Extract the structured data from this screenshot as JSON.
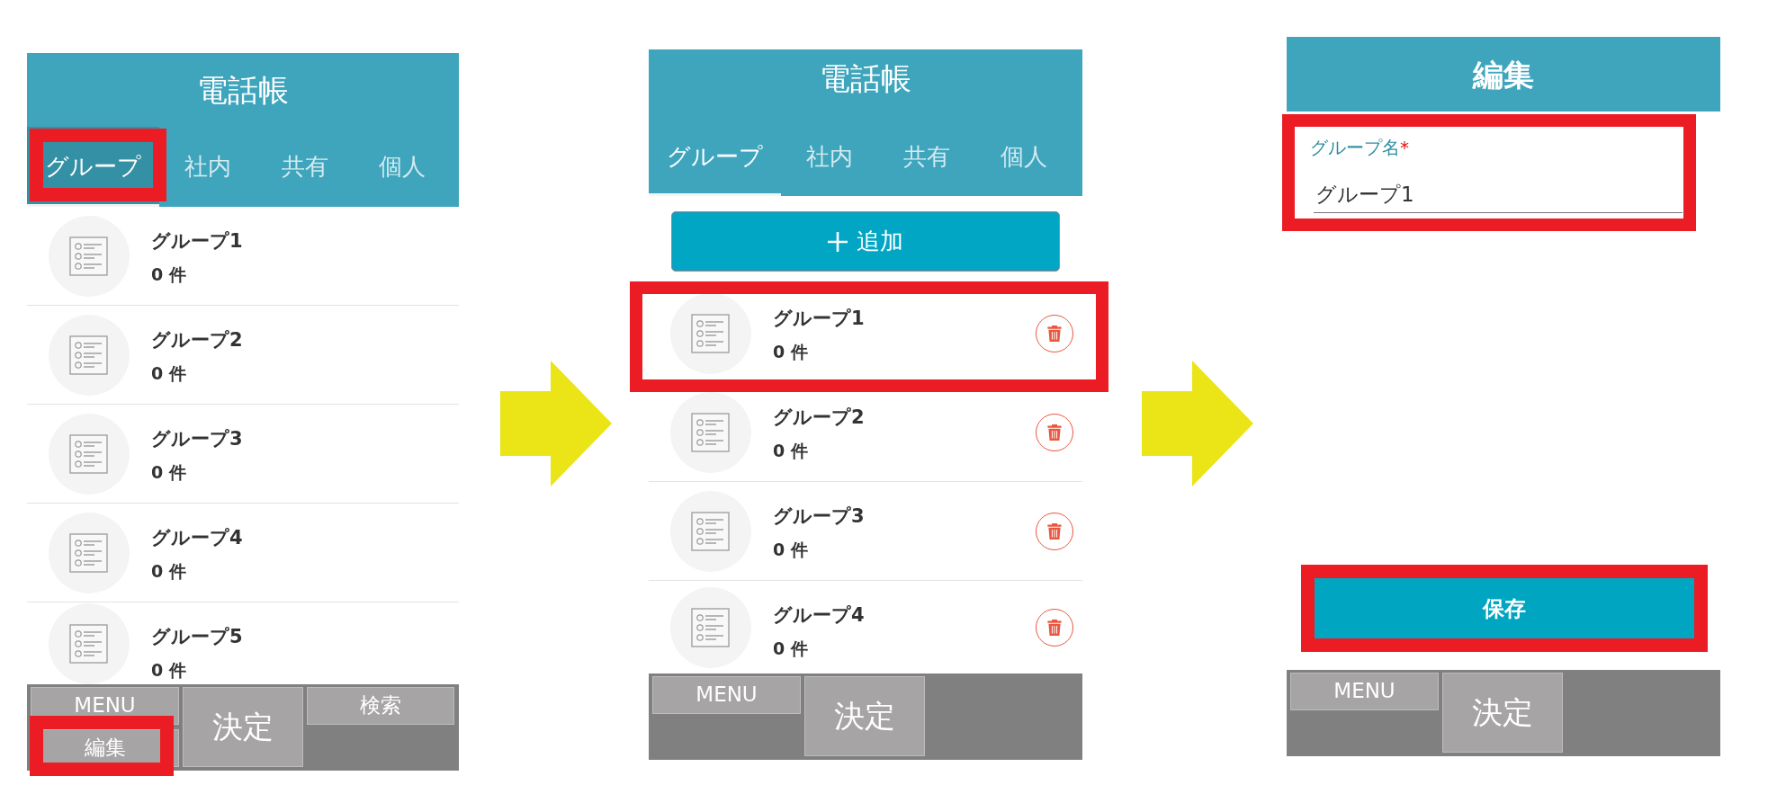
{
  "screens": [
    {
      "kind": "list",
      "title": "電話帳",
      "tabs": [
        {
          "label": "グループ",
          "selected": true,
          "pressed": true,
          "highlighted": true
        },
        {
          "label": "社内",
          "selected": false,
          "pressed": false,
          "highlighted": false
        },
        {
          "label": "共有",
          "selected": false,
          "pressed": false,
          "highlighted": false
        },
        {
          "label": "個人",
          "selected": false,
          "pressed": false,
          "highlighted": false
        }
      ],
      "groups": [
        {
          "name": "グループ1",
          "count": "0 件",
          "deletable": false,
          "highlighted": false
        },
        {
          "name": "グループ2",
          "count": "0 件",
          "deletable": false,
          "highlighted": false
        },
        {
          "name": "グループ3",
          "count": "0 件",
          "deletable": false,
          "highlighted": false
        },
        {
          "name": "グループ4",
          "count": "0 件",
          "deletable": false,
          "highlighted": false
        },
        {
          "name": "グループ5",
          "count": "0 件",
          "deletable": false,
          "highlighted": false
        }
      ],
      "footer": [
        {
          "label": "MENU",
          "kind": "small",
          "highlighted": false
        },
        {
          "label": "編集",
          "kind": "small",
          "highlighted": true
        },
        {
          "label": "決定",
          "kind": "large",
          "highlighted": false
        },
        {
          "label": "検索",
          "kind": "small",
          "highlighted": false
        }
      ]
    },
    {
      "kind": "list",
      "title": "電話帳",
      "tabs": [
        {
          "label": "グループ",
          "selected": true,
          "pressed": false,
          "highlighted": false
        },
        {
          "label": "社内",
          "selected": false,
          "pressed": false,
          "highlighted": false
        },
        {
          "label": "共有",
          "selected": false,
          "pressed": false,
          "highlighted": false
        },
        {
          "label": "個人",
          "selected": false,
          "pressed": false,
          "highlighted": false
        }
      ],
      "add_button": {
        "label": "追加"
      },
      "groups": [
        {
          "name": "グループ1",
          "count": "0 件",
          "deletable": true,
          "highlighted": true
        },
        {
          "name": "グループ2",
          "count": "0 件",
          "deletable": true,
          "highlighted": false
        },
        {
          "name": "グループ3",
          "count": "0 件",
          "deletable": true,
          "highlighted": false
        },
        {
          "name": "グループ4",
          "count": "0 件",
          "deletable": true,
          "highlighted": false
        }
      ],
      "footer": [
        {
          "label": "MENU",
          "kind": "small",
          "highlighted": false
        },
        {
          "label": "決定",
          "kind": "large",
          "highlighted": false
        }
      ]
    },
    {
      "kind": "form",
      "title": "編集",
      "field": {
        "label": "グループ名",
        "required_mark": "*",
        "value": "グループ1",
        "highlighted": true
      },
      "save_button": {
        "label": "保存",
        "highlighted": true
      },
      "footer": [
        {
          "label": "MENU",
          "kind": "small",
          "highlighted": false
        },
        {
          "label": "決定",
          "kind": "large",
          "highlighted": false
        }
      ]
    }
  ]
}
